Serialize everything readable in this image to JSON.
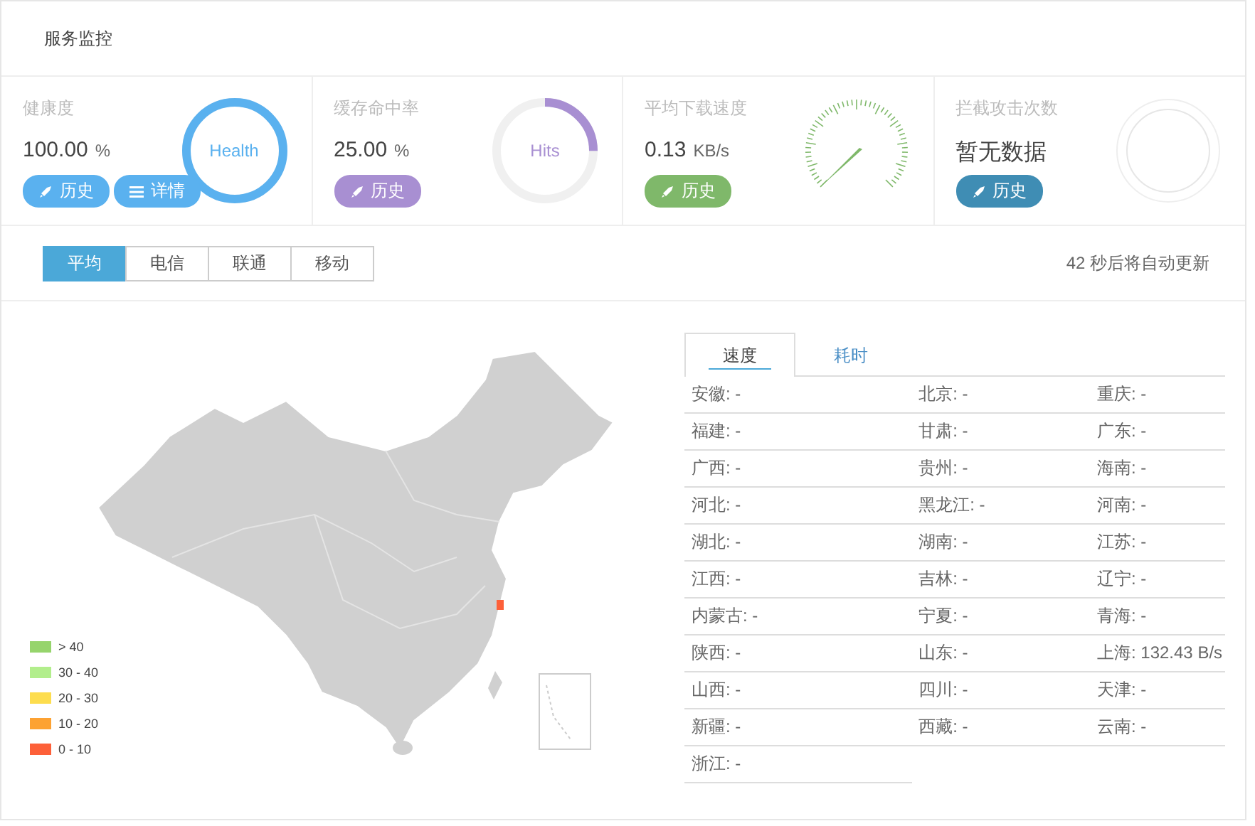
{
  "header": {
    "title": "服务监控"
  },
  "stats": [
    {
      "label": "健康度",
      "value": "100.00",
      "unit": "%",
      "color": "#5ab1ef",
      "dial": {
        "kind": "ring",
        "label": "Health",
        "level": 1
      },
      "buttons": [
        {
          "kind": "history",
          "label": "历史"
        },
        {
          "kind": "detail",
          "label": "详情"
        }
      ]
    },
    {
      "label": "缓存命中率",
      "value": "25.00",
      "unit": "%",
      "color": "#a88fd2",
      "dial": {
        "kind": "ring",
        "label": "Hits",
        "level": 0.25
      },
      "buttons": [
        {
          "kind": "history",
          "label": "历史"
        }
      ]
    },
    {
      "label": "平均下载速度",
      "value": "0.13",
      "unit": "KB/s",
      "color": "#7fb86a",
      "dial": {
        "kind": "gauge"
      },
      "buttons": [
        {
          "kind": "history",
          "label": "历史"
        }
      ]
    },
    {
      "label": "拦截攻击次数",
      "value": "暂无数据",
      "color": "#3f8db4",
      "dial": {
        "kind": "empty"
      },
      "buttons": [
        {
          "kind": "history",
          "label": "历史"
        }
      ]
    }
  ],
  "tabs": [
    {
      "label": "平均",
      "selected": true
    },
    {
      "label": "电信",
      "selected": false
    },
    {
      "label": "联通",
      "selected": false
    },
    {
      "label": "移动",
      "selected": false
    }
  ],
  "countdown": "42 秒后将自动更新",
  "legend": [
    {
      "label": "> 40",
      "color": "#96d46c"
    },
    {
      "label": "30 - 40",
      "color": "#b2ee8c"
    },
    {
      "label": "20 - 30",
      "color": "#fddd4e"
    },
    {
      "label": "10 - 20",
      "color": "#fda232"
    },
    {
      "label": "0 - 10",
      "color": "#fd6039"
    }
  ],
  "detail_tabs": [
    {
      "label": "速度",
      "selected": true
    },
    {
      "label": "耗时",
      "selected": false
    }
  ],
  "provinces": [
    "安徽: -",
    "北京: -",
    "重庆: -",
    "福建: -",
    "甘肃: -",
    "广东: -",
    "广西: -",
    "贵州: -",
    "海南: -",
    "河北: -",
    "黑龙江: -",
    "河南: -",
    "湖北: -",
    "湖南: -",
    "江苏: -",
    "江西: -",
    "吉林: -",
    "辽宁: -",
    "内蒙古: -",
    "宁夏: -",
    "青海: -",
    "陕西: -",
    "山东: -",
    "上海: 132.43 B/s",
    "山西: -",
    "四川: -",
    "天津: -",
    "新疆: -",
    "西藏: -",
    "云南: -",
    "浙江: -"
  ]
}
